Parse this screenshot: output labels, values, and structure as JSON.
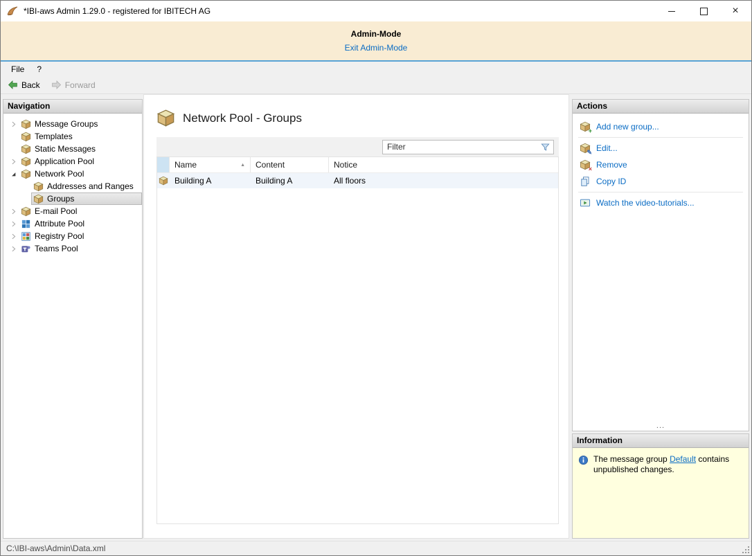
{
  "window": {
    "title": "*IBI-aws Admin 1.29.0 - registered for IBITECH AG"
  },
  "icons": {
    "close_glyph": "×",
    "sort_asc_glyph": "▲",
    "add_overlay": "+",
    "edit_overlay": "✎",
    "remove_overlay": "×"
  },
  "admin_banner": {
    "title": "Admin-Mode",
    "exit_link": "Exit Admin-Mode"
  },
  "menubar": {
    "items": [
      {
        "label": "File"
      },
      {
        "label": "?"
      }
    ]
  },
  "toolbar": {
    "back_label": "Back",
    "forward_label": "Forward"
  },
  "navigation": {
    "header": "Navigation",
    "items": [
      {
        "label": "Message Groups",
        "icon": "pool-box",
        "state": "collapsed",
        "level": 0,
        "selected": false
      },
      {
        "label": "Templates",
        "icon": "pool-box",
        "state": "leaf",
        "level": 0,
        "selected": false
      },
      {
        "label": "Static Messages",
        "icon": "pool-box",
        "state": "leaf",
        "level": 0,
        "selected": false
      },
      {
        "label": "Application Pool",
        "icon": "pool-box",
        "state": "collapsed",
        "level": 0,
        "selected": false
      },
      {
        "label": "Network Pool",
        "icon": "pool-box",
        "state": "expanded",
        "level": 0,
        "selected": false
      },
      {
        "label": "Addresses and Ranges",
        "icon": "pool-box",
        "state": "leaf",
        "level": 1,
        "selected": false
      },
      {
        "label": "Groups",
        "icon": "pool-box",
        "state": "leaf",
        "level": 1,
        "selected": true
      },
      {
        "label": "E-mail Pool",
        "icon": "pool-box",
        "state": "collapsed",
        "level": 0,
        "selected": false
      },
      {
        "label": "Attribute Pool",
        "icon": "attribute-grid",
        "state": "collapsed",
        "level": 0,
        "selected": false
      },
      {
        "label": "Registry Pool",
        "icon": "registry-grid",
        "state": "collapsed",
        "level": 0,
        "selected": false
      },
      {
        "label": "Teams Pool",
        "icon": "teams",
        "state": "collapsed",
        "level": 0,
        "selected": false
      }
    ]
  },
  "main": {
    "title": "Network Pool - Groups",
    "filter": {
      "placeholder": "Filter",
      "value": ""
    },
    "table": {
      "columns": [
        {
          "label": "Name",
          "sorted": "asc"
        },
        {
          "label": "Content",
          "sorted": "none"
        },
        {
          "label": "Notice",
          "sorted": "none"
        }
      ],
      "rows": [
        {
          "name": "Building A",
          "content": "Building A",
          "notice": "All floors"
        }
      ]
    }
  },
  "actions": {
    "header": "Actions",
    "items": [
      {
        "label": "Add new group...",
        "icon": "box-add"
      },
      {
        "label": "Edit...",
        "icon": "box-edit"
      },
      {
        "label": "Remove",
        "icon": "box-remove"
      },
      {
        "label": "Copy ID",
        "icon": "copy-pages"
      },
      {
        "label": "Watch the video-tutorials...",
        "icon": "video"
      }
    ],
    "overflow_indicator": "..."
  },
  "information": {
    "header": "Information",
    "message": {
      "before": "The message group ",
      "link": "Default",
      "after": " contains unpublished changes."
    }
  },
  "statusbar": {
    "path": "C:\\IBI-aws\\Admin\\Data.xml"
  }
}
